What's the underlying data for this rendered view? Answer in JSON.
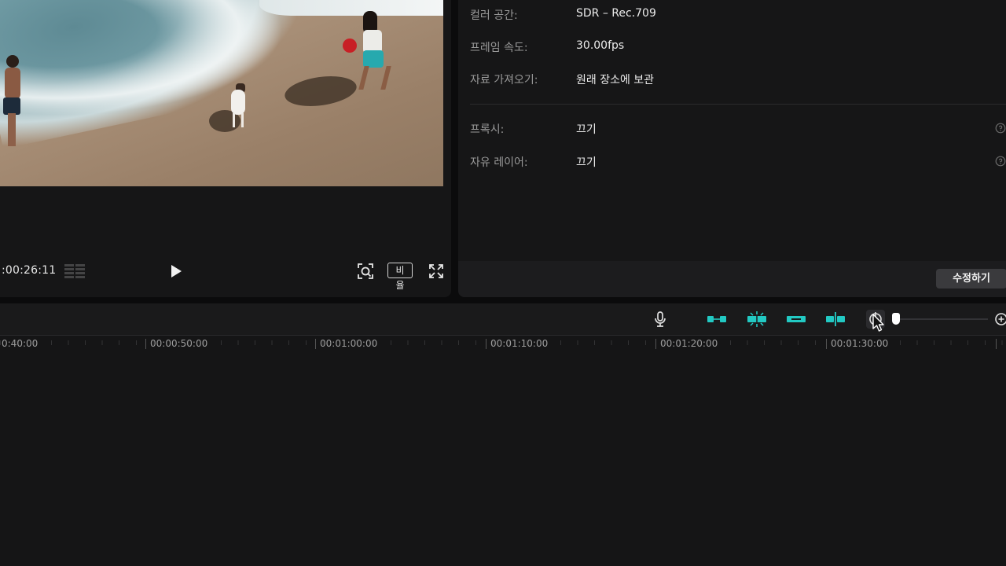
{
  "preview": {
    "timecode": ":00:26:11",
    "ratio_label": "비율",
    "icons": {
      "grid": "grid-icon",
      "play": "play-icon",
      "screenshot": "screenshot-icon",
      "fullscreen": "fullscreen-icon"
    }
  },
  "properties": {
    "rows": [
      {
        "label": "컬러 공간:",
        "value": "SDR – Rec.709"
      },
      {
        "label": "프레임 속도:",
        "value": "30.00fps"
      },
      {
        "label": "자료 가져오기:",
        "value": "원래 장소에 보관"
      },
      {
        "label": "프록시:",
        "value": "끄기"
      },
      {
        "label": "자유 레이어:",
        "value": "끄기"
      }
    ],
    "edit_label": "수정하기"
  },
  "timeline": {
    "tools": [
      {
        "name": "microphone-icon"
      },
      {
        "name": "link-icon"
      },
      {
        "name": "magnet-icon"
      },
      {
        "name": "chain-icon"
      },
      {
        "name": "split-icon"
      },
      {
        "name": "preview-axis-icon"
      }
    ],
    "accent_color": "#22c9c3",
    "zoom_level": 0.0,
    "ruler": [
      "0:40:00",
      "00:00:50:00",
      "00:01:00:00",
      "00:01:10:00",
      "00:01:20:00",
      "00:01:30:00"
    ]
  }
}
